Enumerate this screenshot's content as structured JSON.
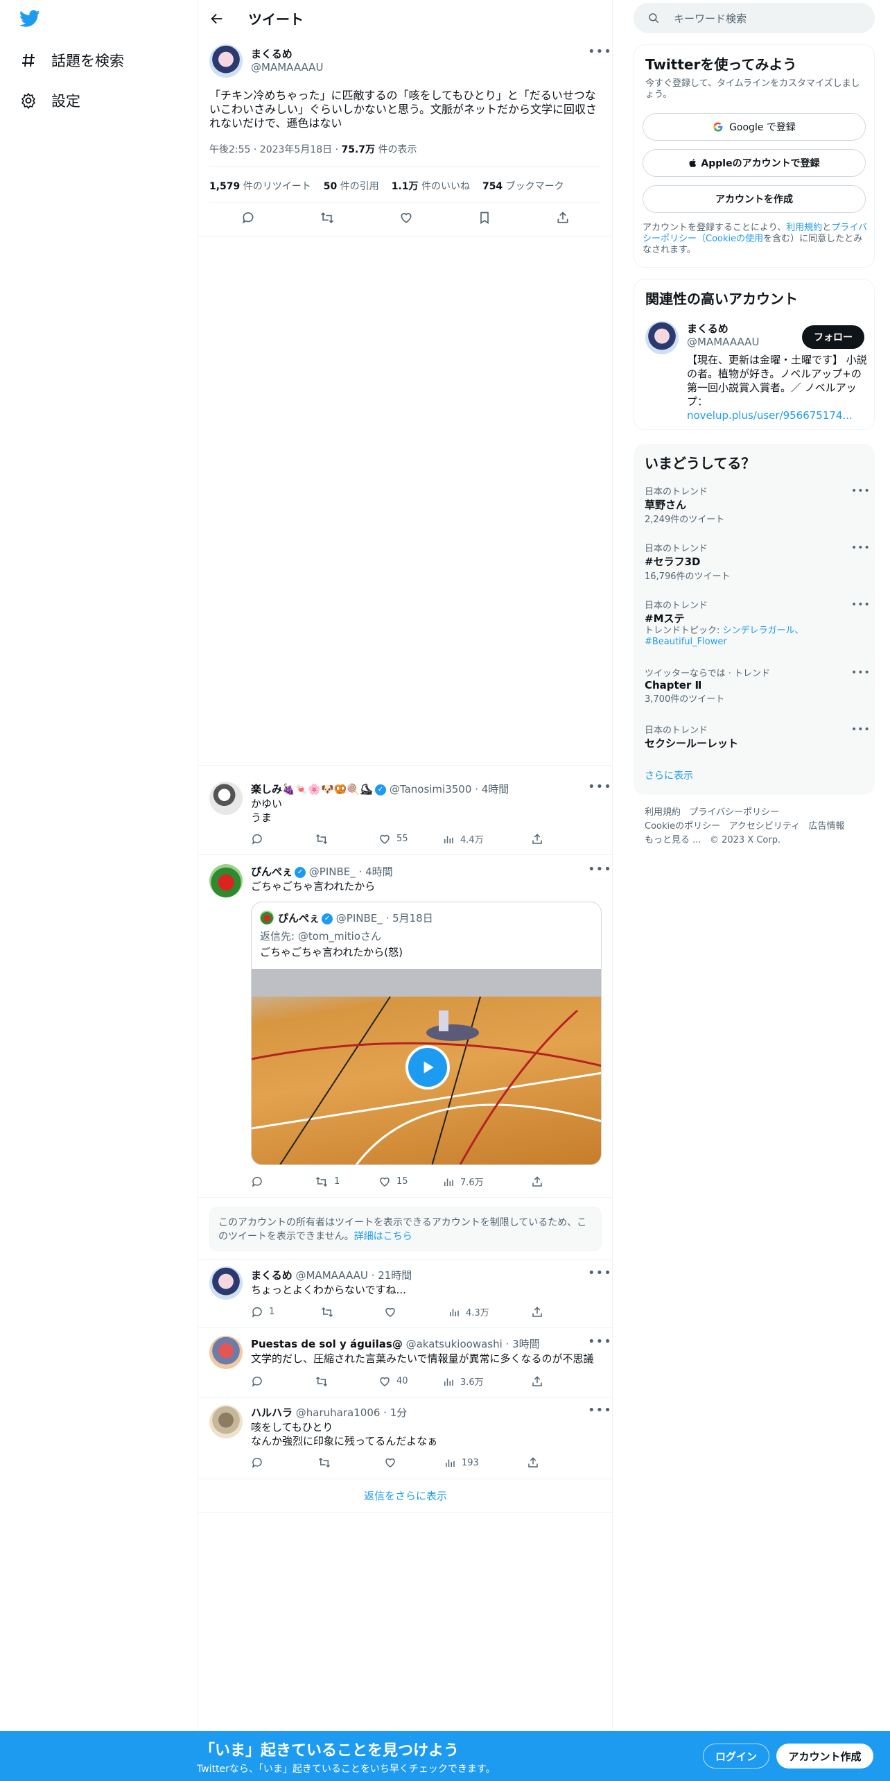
{
  "nav": {
    "explore_label": "話題を検索",
    "settings_label": "設定"
  },
  "header": {
    "title": "ツイート"
  },
  "main_tweet": {
    "name": "まくるめ",
    "handle": "@MAMAAAAU",
    "text": "「チキン冷めちゃった」に匹敵するの「咳をしてもひとり」と「だるいせつないこわいさみしい」ぐらいしかないと思う。文脈がネットだから文学に回収されないだけで、遜色はない",
    "time": "午後2:55 · 2023年5月18日 · ",
    "views_count": "75.7万",
    "views_label": " 件の表示",
    "retweets_count": "1,579",
    "retweets_label": " 件のリツイート",
    "quotes_count": "50",
    "quotes_label": " 件の引用",
    "likes_count": "1.1万",
    "likes_label": " 件のいいね",
    "bookmarks_count": "754",
    "bookmarks_label": " ブックマーク"
  },
  "replies": [
    {
      "name": "楽しみ🍇🍬🌸🐶🥨🍭⛸",
      "handle": "@Tanosimi3500",
      "time": " · 4時間",
      "line1": "かゆい",
      "line2": "うま",
      "reply_count": "",
      "retweet_count": "",
      "like_count": "55",
      "view_count": "4.4万"
    },
    {
      "name": "ぴんぺぇ",
      "handle": "@PINBE_",
      "time": " · 4時間",
      "line1": "ごちゃごちゃ言われたから",
      "reply_count": "",
      "retweet_count": "1",
      "like_count": "15",
      "view_count": "7.6万",
      "quote": {
        "name": "ぴんぺぇ",
        "handle": "@PINBE_",
        "time": " · 5月18日",
        "reply_to_label": "返信先: ",
        "reply_to": "@tom_mitio",
        "reply_to_suffix": "さん",
        "text": "ごちゃごちゃ言われたから(怒)"
      }
    },
    {
      "name": "まくるめ",
      "handle": "@MAMAAAAU",
      "time": " · 21時間",
      "line1": "ちょっとよくわからないですね...",
      "reply_count": "1",
      "retweet_count": "",
      "like_count": "",
      "view_count": "4.3万"
    },
    {
      "name": "Puestas de sol y águilas@",
      "handle": "@akatsukioowashi",
      "time": " · 3時間",
      "line1": "文学的だし、圧縮された言葉みたいで情報量が異常に多くなるのが不思議",
      "reply_count": "",
      "retweet_count": "",
      "like_count": "40",
      "view_count": "3.6万"
    },
    {
      "name": "ハルハラ",
      "handle": "@haruhara1006",
      "time": " · 1分",
      "line1": "咳をしてもひとり",
      "line2": "なんか強烈に印象に残ってるんだよなぁ",
      "reply_count": "",
      "retweet_count": "",
      "like_count": "",
      "view_count": "193"
    }
  ],
  "restricted": {
    "text": "このアカウントの所有者はツイートを表示できるアカウントを制限しているため、このツイートを表示できません。",
    "link": "詳細はこちら"
  },
  "show_more_replies": "返信をさらに表示",
  "search": {
    "placeholder": "キーワード検索"
  },
  "signup": {
    "title": "Twitterを使ってみよう",
    "subtitle": "今すぐ登録して、タイムラインをカスタマイズしましょう。",
    "google": "Google で登録",
    "apple": "Appleのアカウントで登録",
    "create": "アカウントを作成",
    "terms_1": "アカウントを登録することにより、",
    "terms_link1": "利用規約",
    "terms_2": "と",
    "terms_link2": "プライバシーポリシー（Cookieの使用",
    "terms_3": "を含む）に同意したとみなされます。"
  },
  "related": {
    "title": "関連性の高いアカウント",
    "name": "まくるめ",
    "handle": "@MAMAAAAU",
    "follow": "フォロー",
    "bio": "【現在、更新は金曜・土曜です】 小説の者。植物が好き。ノベルアップ+の第一回小説賞入賞者。／ ノベルアップ：",
    "link": "novelup.plus/user/956675174..."
  },
  "trends": {
    "title": "いまどうしてる？",
    "items": [
      {
        "meta": "日本のトレンド",
        "name": "草野さん",
        "count": "2,249件のツイート"
      },
      {
        "meta": "日本のトレンド",
        "name": "#セラフ3D",
        "count": "16,796件のツイート"
      },
      {
        "meta": "日本のトレンド",
        "name": "#Mステ",
        "topic_label": "トレンドトピック: ",
        "topic": "シンデレラガール、#Beautiful_Flower"
      },
      {
        "meta": "ツイッターならでは · トレンド",
        "name": "Chapter Ⅱ",
        "count": "3,700件のツイート"
      },
      {
        "meta": "日本のトレンド",
        "name": "セクシールーレット"
      }
    ],
    "show_more": "さらに表示"
  },
  "footer": {
    "terms": "利用規約",
    "privacy": "プライバシーポリシー",
    "cookie": "Cookieのポリシー",
    "accessibility": "アクセシビリティ",
    "ads": "広告情報",
    "more": "もっと見る ...",
    "copyright": "© 2023 X Corp."
  },
  "bottom": {
    "title": "「いま」起きていることを見つけよう",
    "subtitle": "Twitterなら、「いま」起きていることをいち早くチェックできます。",
    "login": "ログイン",
    "signup": "アカウント作成"
  },
  "colors": {
    "accent": "#1d9bf0",
    "text": "#0f1419",
    "muted": "#536471"
  }
}
